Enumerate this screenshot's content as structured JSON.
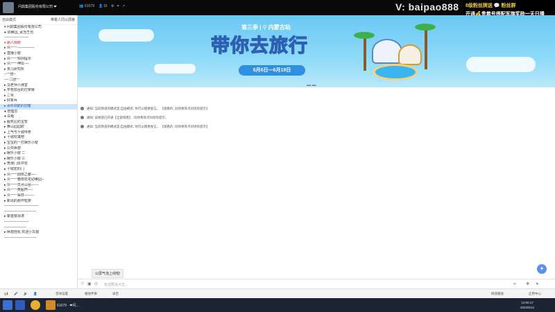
{
  "topbar": {
    "user_name": "问鼎集团股份有限公司 ❤",
    "fans_count": "61079",
    "online_count": "16",
    "watermark": "V:  baipao888",
    "promo_line1": "8级粉丝牌送 💬 粉丝群",
    "promo_line2": "开通💰贵着号搭配军旗奖励一天日播"
  },
  "left_panel": {
    "mode": "自由模式",
    "action": "带着人同以屏蔽",
    "tree": [
      "▾ 问鼎集团股份有限公司",
      "  ● 幼稚园_武当王也",
      "  ──────────",
      "  ▾ 踢人挑衅",
      "  ▸ 众一一───────",
      "  ▸ 直播小窗",
      "  ▸ 众一一规则提示",
      "  ▸ 众一一神坛──",
      "  ▸ 茶几研究所",
      "  ─一团─",
      "  ──二团一",
      "  ▸ 马老师小课堂",
      "  ▸ 学管前台的打架赛",
      "     ▸ 二爷",
      "     ▸ 好家兵",
      "  ▸ 百科领航的创客",
      "     ● 管理员",
      "     ● 白龟",
      "  ▸ 服务区的宝安",
      "  ▸ 黄山园园尉",
      "  ▸ 上气与十城传奇",
      "  ▸ 十城吹凑吧",
      "  ▸ 宝宝的一打娱乐小窗",
      "  ▸ 公共休憩",
      "  ▸ 娱乐小窗  二",
      "  ▸ 娱乐小窗  三",
      "  ▸ 竞演门派冲定",
      "  ▸ 十城宏的门",
      "  ▸ 众一一团体之聚──",
      "  ▸ 众一一春田花花幼稚园─",
      "  ▸ 众一一日月山谷───",
      "  ▸ 众一一英超杯──",
      "  ▸ 众一一采样────",
      "  ▸ 新出的那作框架",
      "  ──────────────",
      "  ─────────────",
      "  ▸ 霍首窗源涛",
      "  ──────────",
      "  ─────────",
      "  ▸ 休憩挂机   欢迎小鸟窗",
      "  ─────────────"
    ]
  },
  "banner": {
    "season": "第三季 | ⚲ 内蒙古站",
    "slogan": "带你去旅行",
    "dates": "6月6日—6月19日",
    "dots": "▬ ▬"
  },
  "messages": [
    "通知:  当前频道的模式是:自由模式, 你可以随便发言。  【观看的,  同场将等点同场有提示】",
    "通知:  该频道已开通【全部观看】,  同场将等点同场有提示。",
    "通知:  当前频道的模式是:自由模式, 你可以随便发言。  【观看的,  同场将等点同场有提示】"
  ],
  "tip": "公屏气泡上线啦!",
  "input": {
    "placeholder": "有话要说点击..."
  },
  "statusbar": {
    "items": [
      "📢",
      "🎤",
      "🔊",
      "👤",
      "音效设置",
      "播放伴奏",
      "录音"
    ],
    "right_items": [
      "频道播放",
      "应用中心"
    ]
  },
  "taskbar": {
    "app_label": "61079 · ❤问...",
    "time": "12:00:17",
    "date": "2022/6/12"
  },
  "colors": {
    "accent_blue": "#2f8fe0",
    "slogan_yellow": "#ffc62b",
    "selection": "#cfe5fb"
  }
}
